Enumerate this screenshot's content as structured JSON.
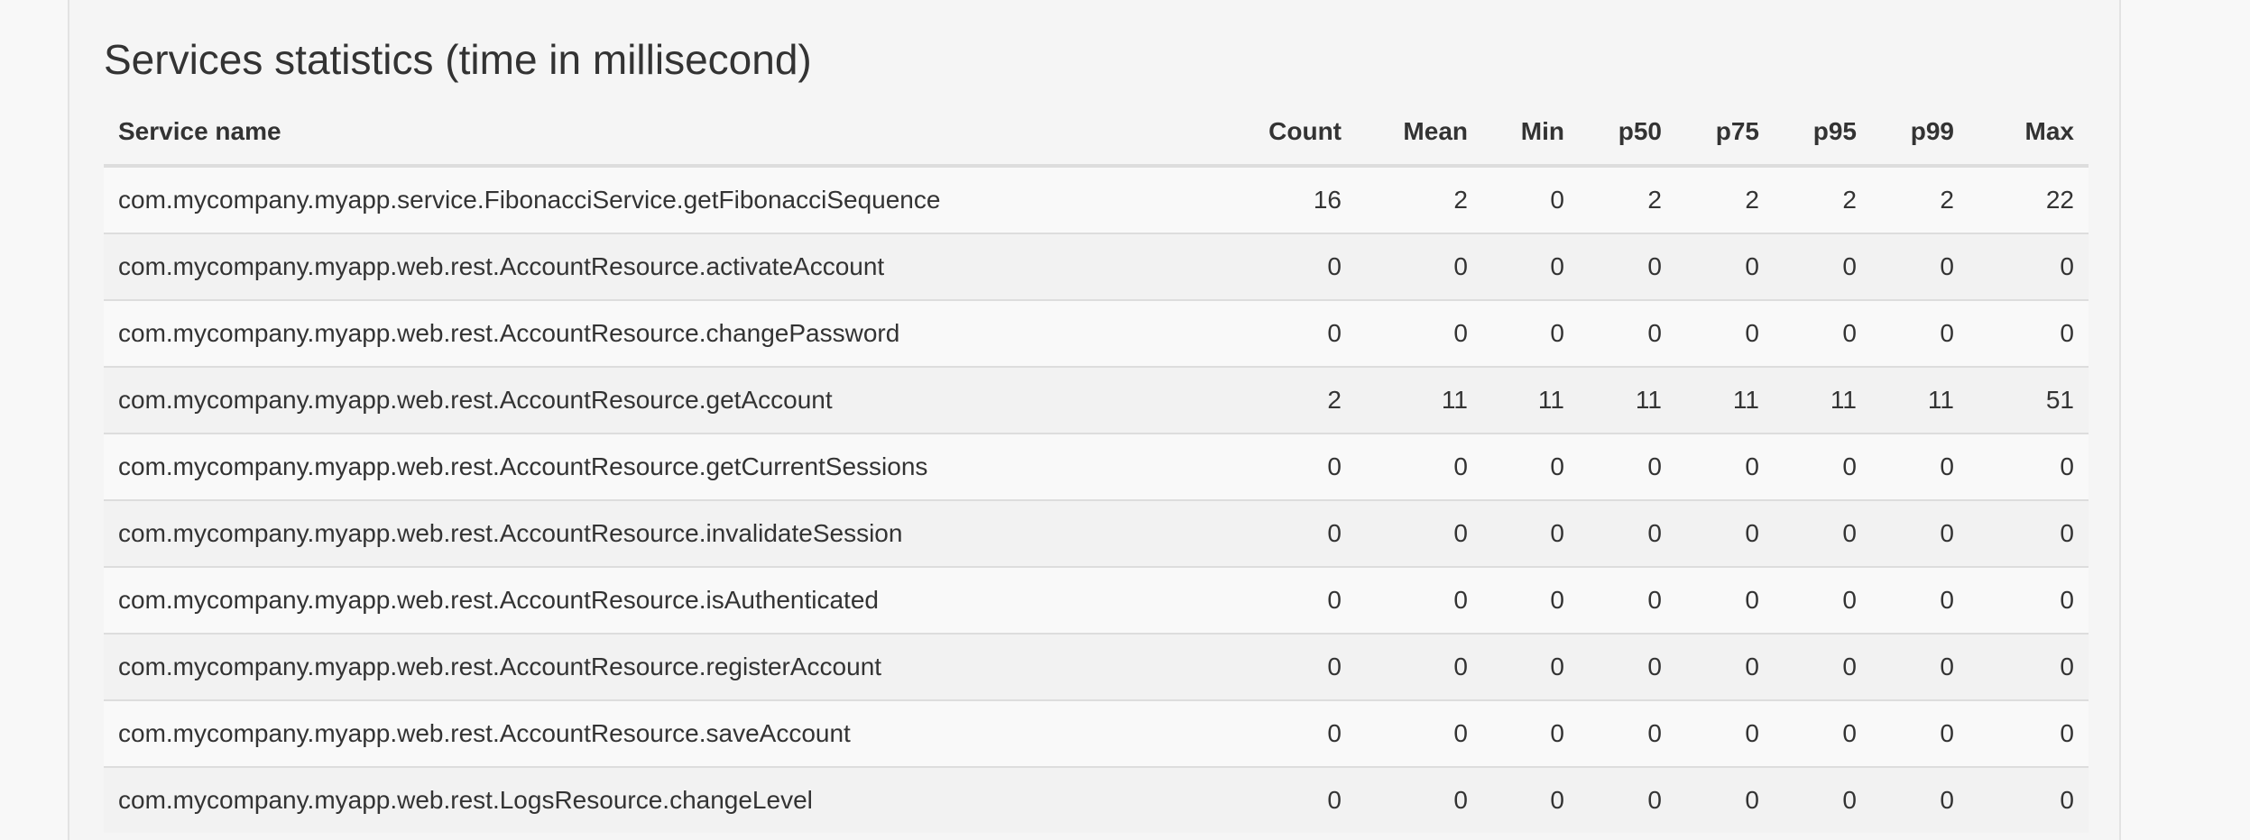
{
  "section_title": "Services statistics (time in millisecond)",
  "table": {
    "headers": [
      "Service name",
      "Count",
      "Mean",
      "Min",
      "p50",
      "p75",
      "p95",
      "p99",
      "Max"
    ],
    "rows": [
      [
        "com.mycompany.myapp.service.FibonacciService.getFibonacciSequence",
        "16",
        "2",
        "0",
        "2",
        "2",
        "2",
        "2",
        "22"
      ],
      [
        "com.mycompany.myapp.web.rest.AccountResource.activateAccount",
        "0",
        "0",
        "0",
        "0",
        "0",
        "0",
        "0",
        "0"
      ],
      [
        "com.mycompany.myapp.web.rest.AccountResource.changePassword",
        "0",
        "0",
        "0",
        "0",
        "0",
        "0",
        "0",
        "0"
      ],
      [
        "com.mycompany.myapp.web.rest.AccountResource.getAccount",
        "2",
        "11",
        "11",
        "11",
        "11",
        "11",
        "11",
        "51"
      ],
      [
        "com.mycompany.myapp.web.rest.AccountResource.getCurrentSessions",
        "0",
        "0",
        "0",
        "0",
        "0",
        "0",
        "0",
        "0"
      ],
      [
        "com.mycompany.myapp.web.rest.AccountResource.invalidateSession",
        "0",
        "0",
        "0",
        "0",
        "0",
        "0",
        "0",
        "0"
      ],
      [
        "com.mycompany.myapp.web.rest.AccountResource.isAuthenticated",
        "0",
        "0",
        "0",
        "0",
        "0",
        "0",
        "0",
        "0"
      ],
      [
        "com.mycompany.myapp.web.rest.AccountResource.registerAccount",
        "0",
        "0",
        "0",
        "0",
        "0",
        "0",
        "0",
        "0"
      ],
      [
        "com.mycompany.myapp.web.rest.AccountResource.saveAccount",
        "0",
        "0",
        "0",
        "0",
        "0",
        "0",
        "0",
        "0"
      ],
      [
        "com.mycompany.myapp.web.rest.LogsResource.changeLevel",
        "0",
        "0",
        "0",
        "0",
        "0",
        "0",
        "0",
        "0"
      ]
    ]
  }
}
